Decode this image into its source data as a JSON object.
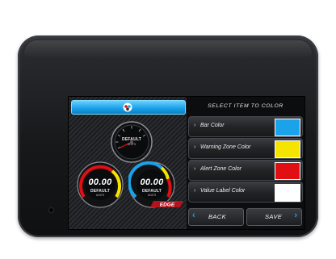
{
  "header": {
    "logo_icon": "edge-logo-icon"
  },
  "gauges": {
    "center": {
      "default_label": "DEFAULT",
      "units_label": "UNITS"
    },
    "left": {
      "value": "00.00",
      "default_label": "DEFAULT",
      "units_label": "UNITS"
    },
    "right": {
      "value": "00.00",
      "default_label": "DEFAULT",
      "units_label": "UNITS"
    }
  },
  "menu": {
    "title": "SELECT ITEM TO COLOR",
    "items": [
      {
        "label": "Bar Color",
        "color": "#1aa3ea"
      },
      {
        "label": "Warning Zone Color",
        "color": "#f5e400"
      },
      {
        "label": "Alert Zone Color",
        "color": "#e10f12"
      },
      {
        "label": "Value Label Color",
        "color": "#ffffff"
      }
    ]
  },
  "nav": {
    "back_label": "BACK",
    "save_label": "SAVE"
  },
  "brand": {
    "text": "EDGE"
  },
  "colors": {
    "accent": "#1aa3ea",
    "warning": "#f5e400",
    "alert": "#e10f12"
  }
}
